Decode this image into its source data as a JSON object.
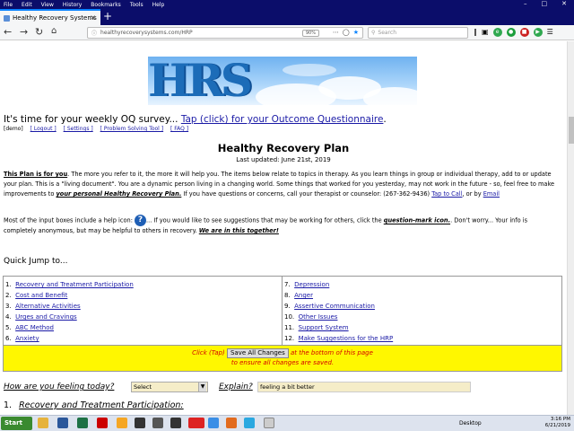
{
  "browser": {
    "menu": [
      "File",
      "Edit",
      "View",
      "History",
      "Bookmarks",
      "Tools",
      "Help"
    ],
    "tab_title": "Healthy Recovery Systems",
    "url": "healthyrecoverysystems.com/HRP",
    "zoom": "90%",
    "search_placeholder": "Search"
  },
  "header": {
    "logo_text": "HRS",
    "oq_prefix": "It's time for your weekly OQ survey...",
    "oq_link": "Tap (click) for your Outcome Questionnaire",
    "oq_suffix": ".",
    "user": "[demo]",
    "nav_links": [
      "[ Logout ]",
      "[ Settings ]",
      "[ Problem Solving Tool ]",
      "[ FAQ ]"
    ]
  },
  "plan": {
    "title": "Healthy Recovery Plan",
    "updated": "Last updated: June 21st, 2019",
    "intro_lead": "This Plan is for you",
    "intro_1": ". The more you refer to it, the more it will help you. The items below relate to topics in therapy. As you learn things in group or individual therapy, add to or update your plan.  This is a \"living document\".  You are a dynamic person  living in a changing world.  Some things that worked for you yesterday, may not work in the future - so, feel free to make improvements to ",
    "intro_emph": "your personal Healthy Recovery Plan.",
    "intro_2": "  If you have questions or concerns, call your therapist or counselor: (267-362-9436) ",
    "tap_to_call": "Tap to Call",
    "or_by": ", or by ",
    "email": "Email",
    "help_1": "Most of the input boxes include a help icon: ",
    "help_icon": "?",
    "help_2": "...  If you would like to see suggestions that may be working for others, click the ",
    "help_emph": "question-mark icon.",
    "help_3": ".  Don't worry... Your info is completely anonymous, but may be helpful to others in recovery.  ",
    "help_together": "We are in this together!"
  },
  "quick_jump": {
    "heading": "Quick Jump to...",
    "left": [
      {
        "num": "1.",
        "label": "Recovery and Treatment Participation"
      },
      {
        "num": "2.",
        "label": "Cost and Benefit"
      },
      {
        "num": "3.",
        "label": "Alternative Activities"
      },
      {
        "num": "4.",
        "label": "Urges and Cravings"
      },
      {
        "num": "5.",
        "label": "ABC Method"
      },
      {
        "num": "6.",
        "label": "Anxiety"
      }
    ],
    "right": [
      {
        "num": "7.",
        "label": "Depression"
      },
      {
        "num": "8.",
        "label": "Anger"
      },
      {
        "num": "9.",
        "label": "Assertive Communication"
      },
      {
        "num": "10.",
        "label": "Other Issues"
      },
      {
        "num": "11.",
        "label": "Support System"
      },
      {
        "num": "12.",
        "label": "Make Suggestions for the HRP"
      }
    ]
  },
  "save": {
    "pre": "Click (Tap) ",
    "button": "Save All Changes",
    "post": " at the bottom of this page",
    "line2": "to ensure all changes are saved."
  },
  "feeling": {
    "label": "How are you feeling today?",
    "select_value": "Select",
    "explain_label": "Explain?",
    "explain_value": "feeling a bit better"
  },
  "section1": {
    "num": "1.",
    "title": "Recovery and Treatment Participation:"
  },
  "taskbar": {
    "start": "Start",
    "desktop": "Desktop",
    "time": "3:16 PM",
    "date": "6/21/2019"
  }
}
